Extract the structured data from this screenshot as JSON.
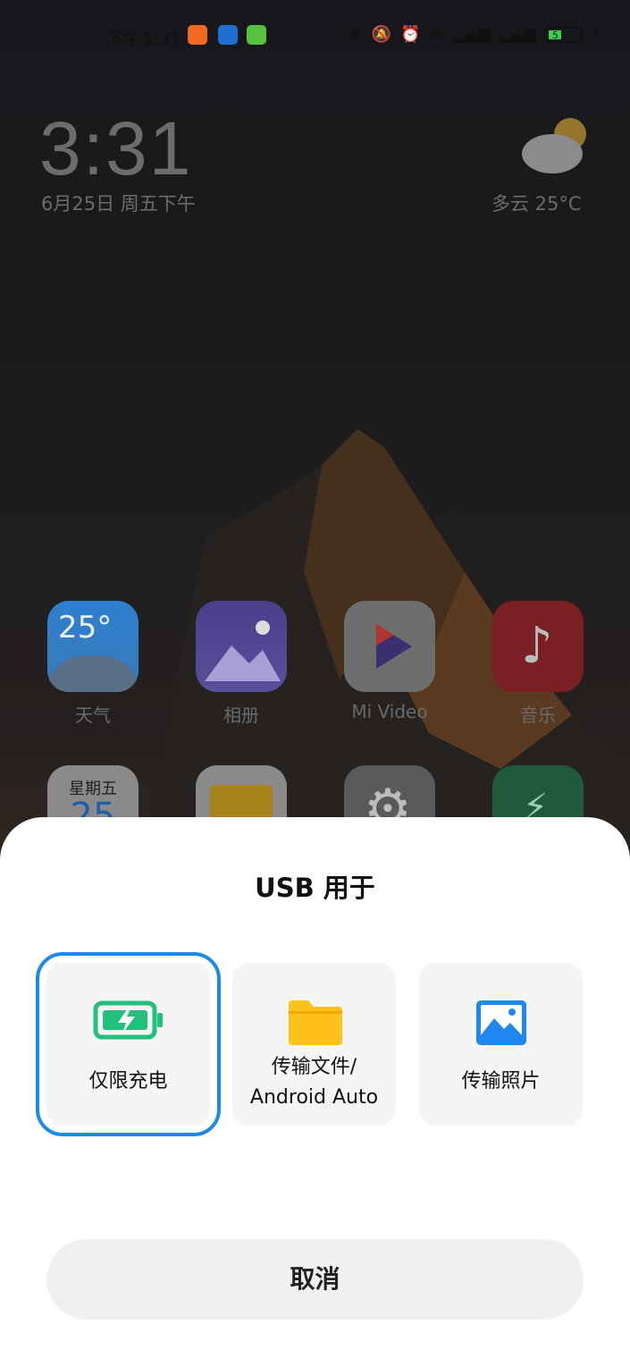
{
  "statusbar": {
    "time": "下午3:31",
    "network": "5G",
    "battery": "5"
  },
  "lockscreen": {
    "clock": "3:31",
    "date": "6月25日 周五下午",
    "weather": "多云   25°C"
  },
  "home_apps": [
    {
      "label": "天气",
      "icon": "weather-icon",
      "badge": "25°"
    },
    {
      "label": "相册",
      "icon": "gallery-icon"
    },
    {
      "label": "Mi Video",
      "icon": "video-icon"
    },
    {
      "label": "音乐",
      "icon": "music-icon"
    }
  ],
  "home_apps_row2": [
    {
      "label": "星期五",
      "badge": "25",
      "icon": "calendar-icon"
    },
    {
      "icon": "files-icon"
    },
    {
      "icon": "settings-icon"
    },
    {
      "icon": "security-icon"
    }
  ],
  "usb_dialog": {
    "title": "USB 用于",
    "options": [
      {
        "label": "仅限充电",
        "icon": "battery-charging-icon",
        "selected": true
      },
      {
        "label_line1": "传输文件/",
        "label_line2": "Android Auto",
        "icon": "folder-icon",
        "selected": false
      },
      {
        "label": "传输照片",
        "icon": "photo-icon",
        "selected": false
      }
    ],
    "cancel_label": "取消"
  },
  "colors": {
    "accent": "#1e88e5",
    "charge_green": "#22c07a",
    "folder_yellow": "#ffc21a",
    "photo_blue": "#1f87f0"
  }
}
